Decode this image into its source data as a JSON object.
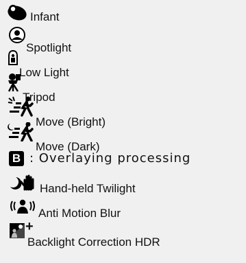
{
  "items": [
    {
      "icon": "infant-icon",
      "label": "Infant"
    },
    {
      "icon": "spotlight-icon",
      "label": "Spotlight"
    },
    {
      "icon": "low-light-icon",
      "label": "Low Light"
    },
    {
      "icon": "tripod-icon",
      "label": "Tripod"
    },
    {
      "icon": "move-bright-icon",
      "label": "Move (Bright)"
    },
    {
      "icon": "move-dark-icon",
      "label": "Move (Dark)"
    },
    {
      "icon": "overlay-b-icon",
      "label": ": Overlaying processing",
      "glyph": "B"
    },
    {
      "icon": "hand-held-twilight-icon",
      "label": "Hand-held Twilight"
    },
    {
      "icon": "anti-motion-blur-icon",
      "label": "Anti Motion Blur"
    },
    {
      "icon": "backlight-hdr-icon",
      "label": "Backlight Correction HDR",
      "glyph": "+"
    }
  ]
}
